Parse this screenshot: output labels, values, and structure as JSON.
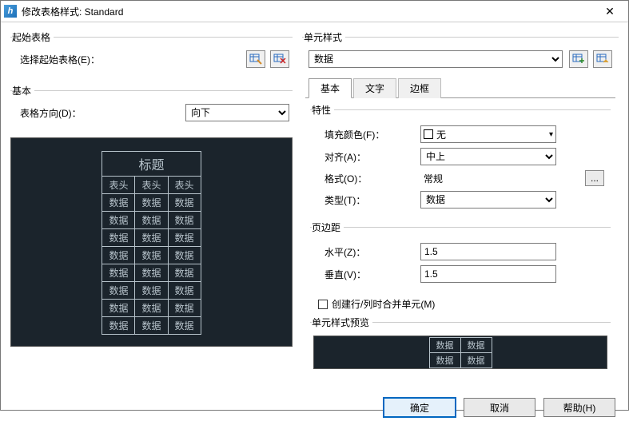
{
  "titlebar": {
    "title": "修改表格样式: Standard",
    "close": "✕"
  },
  "start_table": {
    "legend": "起始表格",
    "select_label": "选择起始表格(E)："
  },
  "basic": {
    "legend": "基本",
    "direction_label": "表格方向(D)：",
    "direction_value": "向下"
  },
  "preview": {
    "title_row": "标题",
    "header": [
      "表头",
      "表头",
      "表头"
    ],
    "data_rows": [
      [
        "数据",
        "数据",
        "数据"
      ],
      [
        "数据",
        "数据",
        "数据"
      ],
      [
        "数据",
        "数据",
        "数据"
      ],
      [
        "数据",
        "数据",
        "数据"
      ],
      [
        "数据",
        "数据",
        "数据"
      ],
      [
        "数据",
        "数据",
        "数据"
      ],
      [
        "数据",
        "数据",
        "数据"
      ],
      [
        "数据",
        "数据",
        "数据"
      ]
    ]
  },
  "cell_style": {
    "legend": "单元样式",
    "selector_value": "数据",
    "tabs": [
      "基本",
      "文字",
      "边框"
    ],
    "active_tab": 0,
    "properties": {
      "legend": "特性",
      "fill_label": "填充颜色(F)：",
      "fill_value": "无",
      "align_label": "对齐(A)：",
      "align_value": "中上",
      "format_label": "格式(O)：",
      "format_value": "常规",
      "type_label": "类型(T)：",
      "type_value": "数据"
    },
    "margin": {
      "legend": "页边距",
      "horiz_label": "水平(Z)：",
      "horiz_value": "1.5",
      "vert_label": "垂直(V)：",
      "vert_value": "1.5"
    },
    "merge_checkbox": "创建行/列时合并单元(M)",
    "style_preview_legend": "单元样式预览",
    "mini_data": [
      [
        "数据",
        "数据"
      ],
      [
        "数据",
        "数据"
      ]
    ]
  },
  "footer": {
    "ok": "确定",
    "cancel": "取消",
    "help": "帮助(H)"
  }
}
